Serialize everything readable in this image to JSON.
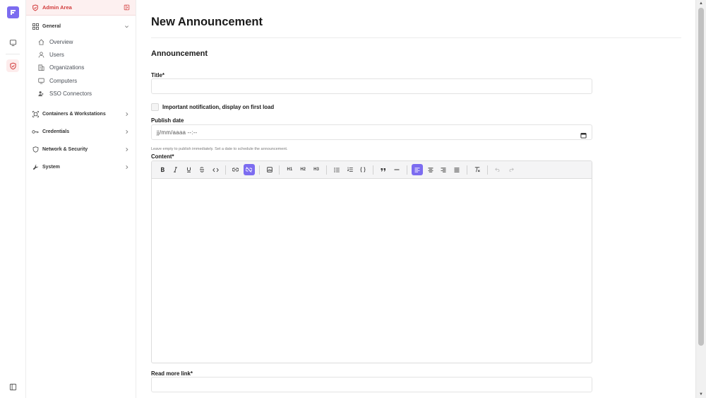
{
  "sidebar": {
    "header": "Admin Area",
    "groups": [
      {
        "label": "General",
        "items": [
          "Overview",
          "Users",
          "Organizations",
          "Computers",
          "SSO Connectors"
        ]
      },
      {
        "label": "Containers & Workstations"
      },
      {
        "label": "Credentials"
      },
      {
        "label": "Network & Security"
      },
      {
        "label": "System"
      }
    ]
  },
  "main": {
    "page_title": "New Announcement",
    "section_title": "Announcement",
    "title_label": "Title*",
    "title_value": "",
    "important_label": "Important notification, display on first load",
    "important_checked": false,
    "publish_label": "Publish date",
    "publish_placeholder": "jj/mm/aaaa  --:--",
    "publish_help": "Leave empty to publish immediately. Set a date to schedule the announcement.",
    "content_label": "Content*",
    "readmore_label": "Read more link*",
    "readmore_value": ""
  },
  "toolbar": {
    "buttons": [
      "bold-icon",
      "italic-icon",
      "underline-icon",
      "strikethrough-icon",
      "code-icon",
      "link-icon",
      "unlink-icon",
      "image-icon",
      "h1",
      "h2",
      "h3",
      "bullet-list-icon",
      "ordered-list-icon",
      "code-block-icon",
      "quote-icon",
      "horizontal-rule-icon",
      "align-left-icon",
      "align-center-icon",
      "align-right-icon",
      "align-justify-icon",
      "clear-format-icon",
      "undo-icon",
      "redo-icon"
    ],
    "h1": "H1",
    "h2": "H2",
    "h3": "H3",
    "active": [
      "unlink-icon",
      "align-left-icon"
    ]
  },
  "colors": {
    "accent": "#7c6cf0",
    "admin_red": "#d23c3c",
    "admin_bg": "#fdf0f0"
  }
}
